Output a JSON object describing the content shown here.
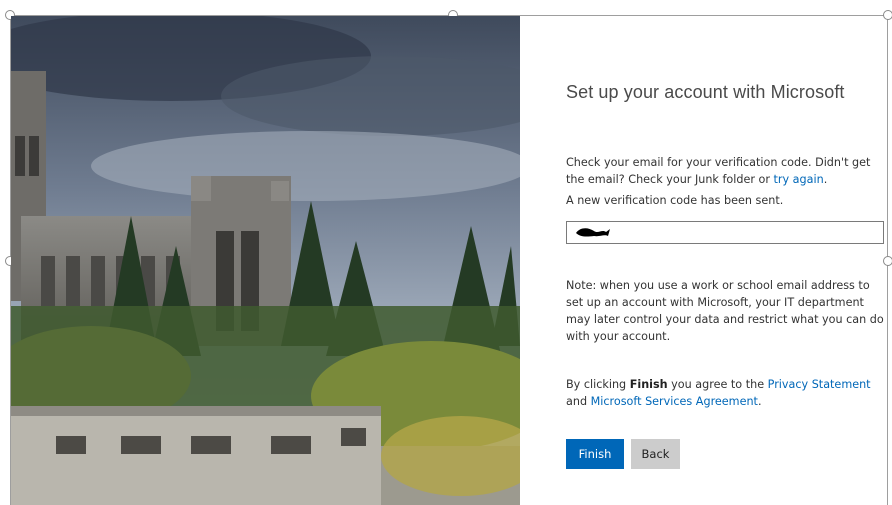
{
  "dialog": {
    "title": "Set up your account with Microsoft",
    "verify_text_before_link": "Check your email for your verification code. Didn't get the email? Check your Junk folder or ",
    "try_again_link": "try again",
    "verify_text_after_link": ".",
    "sent_notice": "A new verification code has been sent.",
    "code_input": {
      "value": "",
      "placeholder": ""
    },
    "note": "Note: when you use a work or school email address to set up an account with Microsoft, your IT department may later control your data and restrict what you can do with your account.",
    "agree_before_bold": "By clicking ",
    "agree_bold": "Finish",
    "agree_after_bold": " you agree to the ",
    "privacy_link": "Privacy Statement",
    "agree_and": " and ",
    "services_link": "Microsoft Services Agreement",
    "agree_end": "."
  },
  "buttons": {
    "finish_label": "Finish",
    "back_label": "Back"
  },
  "colors": {
    "accent": "#0067b8",
    "secondary_button": "#cccccc",
    "text": "#333333"
  }
}
